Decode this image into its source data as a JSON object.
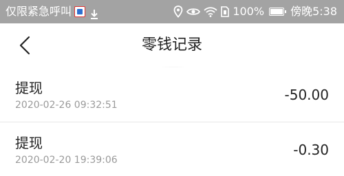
{
  "status_bar": {
    "carrier_text": "仅限紧急呼叫",
    "battery_percent": "100%",
    "time": "傍晚5:38",
    "icons": [
      "app-icon",
      "download-icon",
      "location-icon",
      "eye-icon",
      "wifi-icon",
      "sim-icon",
      "battery-icon"
    ]
  },
  "nav": {
    "title": "零钱记录",
    "back_icon": "chevron-left-icon"
  },
  "records": [
    {
      "title": "提现",
      "time": "2020-02-26 09:32:51",
      "amount": "-50.00"
    },
    {
      "title": "提现",
      "time": "2020-02-20 19:39:06",
      "amount": "-0.30"
    }
  ],
  "colors": {
    "status_bar_bg": "#a3a3a3",
    "text_primary": "#222222",
    "text_secondary": "#9a9a9a",
    "divider": "#e6e6e6"
  }
}
